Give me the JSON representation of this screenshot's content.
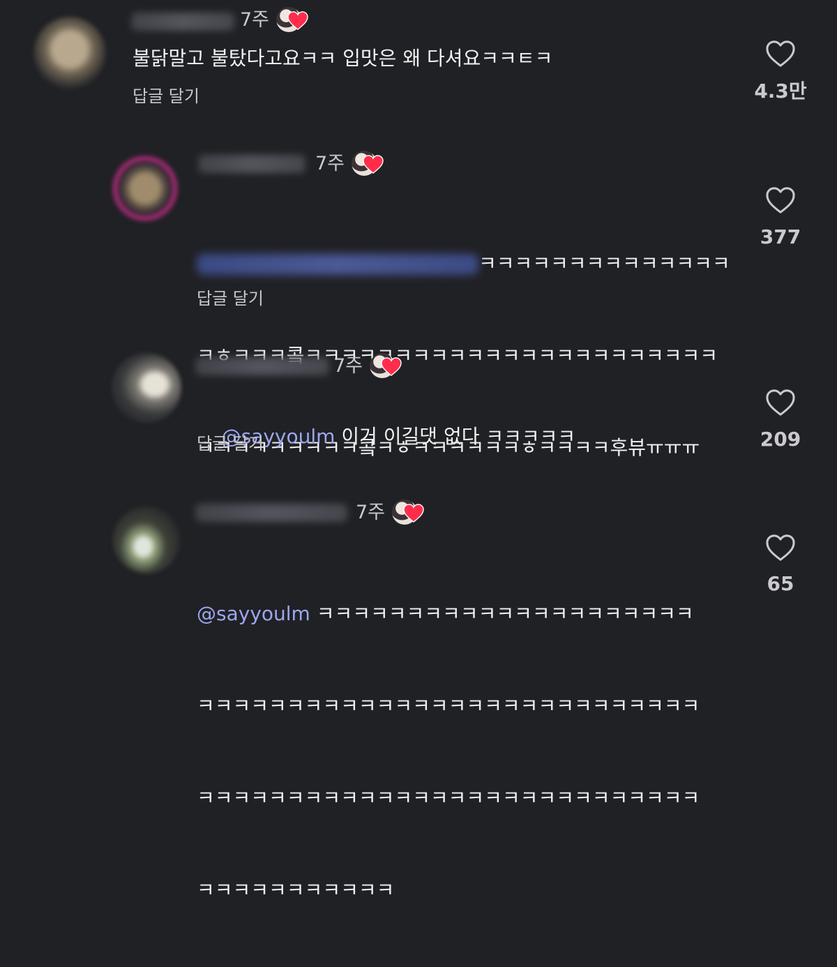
{
  "colors": {
    "background": "#202125",
    "text": "#f1f1f3",
    "mention": "#9da7ee",
    "muted": "#c7c7cc",
    "author_heart": "#ff2d4b"
  },
  "comments": [
    {
      "username": "",
      "time": "7주",
      "text": "불닭말고 불탔다고요ㅋㅋ 입맛은 왜 다셔요ㅋㅋㅌㅋ",
      "reply_label": "답글 달기",
      "likes": "4.3만",
      "author_liked": true
    },
    {
      "username": "",
      "time": "7주",
      "mention": "",
      "text_lines": [
        "ㅋㅋㅋㅋㅋㅋㅋㅋㅋㅋㅋㅋㅋㅋ",
        "ㅋㅎㅋㅋㅋ콬ㅋㅋㅋㅋㅋㅋㅋㅋㅋㅋㅋㅋㅋㅋㅋㅋㅋㅋㅋㅋㅋㅋㅋ",
        "ㅋㅋㅋㅋㅋㅋㅋㅋㅋ콬ㅋㅎㅋㅋㅋㅋㅋㅋㅎㅋㅋㅋㅋ후뷰ㅠㅠㅠ"
      ],
      "reply_label": "답글 달기",
      "likes": "377",
      "author_liked": true
    },
    {
      "username": "",
      "time": "7주",
      "mention": "@sayyoulm",
      "text": " 이거 이길댓 없다 ㅋㅋㅋㅋㅋ",
      "reply_label": "답글 달기",
      "likes": "209",
      "author_liked": true
    },
    {
      "username": "",
      "time": "7주",
      "mention": "@sayyoulm",
      "text_lines": [
        " ㅋㅋㅋㅋㅋㅋㅋㅋㅋㅋㅋㅋㅋㅋㅋㅋㅋㅋㅋㅋㅋ",
        "ㅋㅋㅋㅋㅋㅋㅋㅋㅋㅋㅋㅋㅋㅋㅋㅋㅋㅋㅋㅋㅋㅋㅋㅋㅋㅋㅋㅋ",
        "ㅋㅋㅋㅋㅋㅋㅋㅋㅋㅋㅋㅋㅋㅋㅋㅋㅋㅋㅋㅋㅋㅋㅋㅋㅋㅋㅋㅋ",
        "ㅋㅋㅋㅋㅋㅋㅋㅋㅋㅋㅋ"
      ],
      "likes": "65",
      "author_liked": true
    }
  ]
}
